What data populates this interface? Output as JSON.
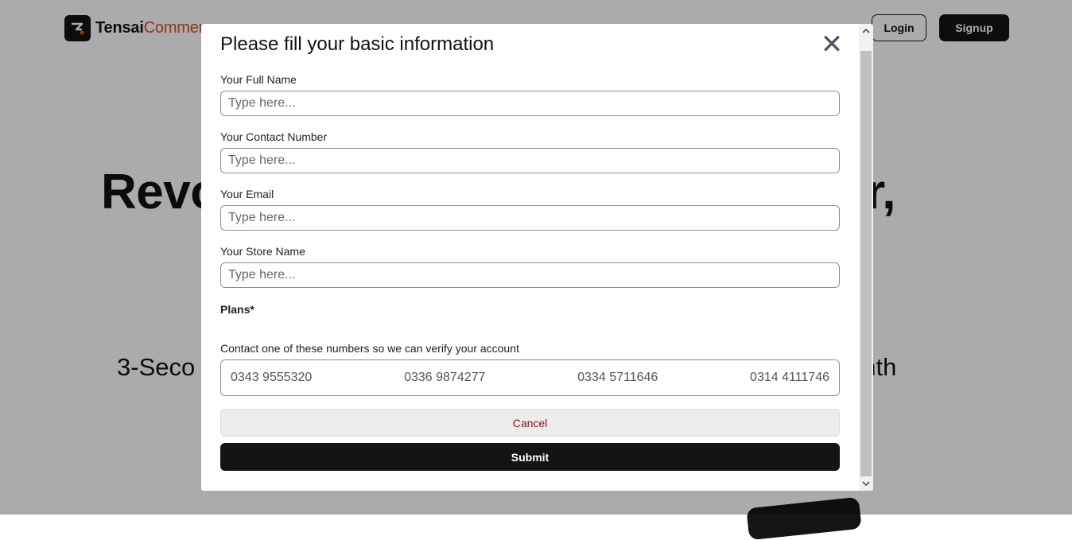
{
  "header": {
    "logo_bold": "Tensai",
    "logo_accent": "Commer",
    "login_label": "Login",
    "signup_label": "Signup"
  },
  "hero": {
    "title_left": "Revo",
    "title_right": "er,",
    "subtitle_left": "3-Seco",
    "subtitle_right": "onth"
  },
  "modal": {
    "title": "Please fill your basic information",
    "close_symbol": "✕",
    "fields": [
      {
        "label": "Your Full Name",
        "placeholder": "Type here...",
        "value": ""
      },
      {
        "label": "Your Contact Number",
        "placeholder": "Type here...",
        "value": ""
      },
      {
        "label": "Your Email",
        "placeholder": "Type here...",
        "value": ""
      },
      {
        "label": "Your Store Name",
        "placeholder": "Type here...",
        "value": ""
      }
    ],
    "plans_label": "Plans*",
    "contact_label": "Contact one of these numbers so we can verify your account",
    "numbers": [
      "0343 9555320",
      "0336 9874277",
      "0334 5711646",
      "0314 4111746"
    ],
    "cancel_label": "Cancel",
    "submit_label": "Submit"
  },
  "colors": {
    "accent": "#d4512b",
    "primary_dark": "#141414",
    "cancel_text": "#8b1420"
  }
}
